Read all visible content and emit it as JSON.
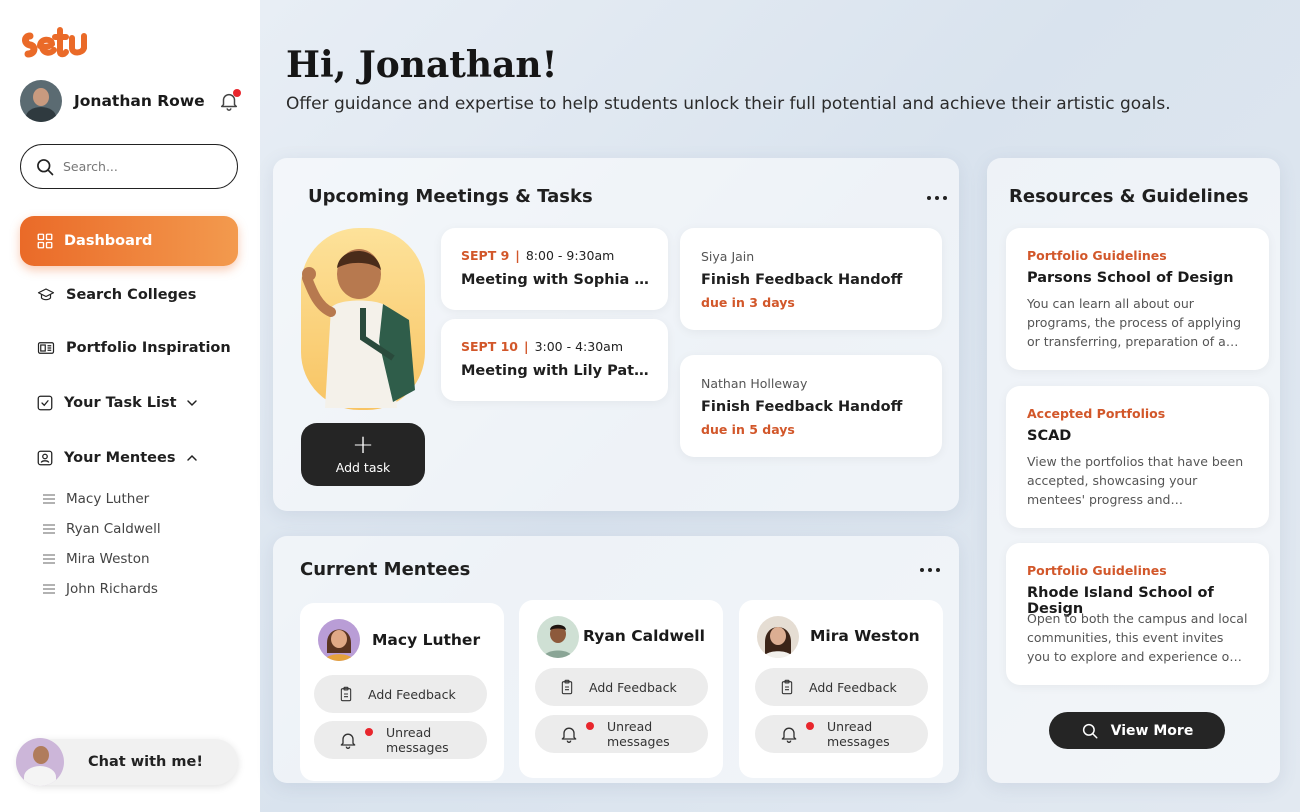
{
  "app": {
    "logo_text": "setu",
    "brand_color": "#ea6a28",
    "accent_text_color": "#d2572a"
  },
  "user": {
    "name": "Jonathan Rowe",
    "notification_dot": true
  },
  "search": {
    "placeholder": "Search..."
  },
  "nav": {
    "items": [
      {
        "label": "Dashboard",
        "icon": "grid-icon",
        "active": true
      },
      {
        "label": "Search Colleges",
        "icon": "graduation-cap-icon"
      },
      {
        "label": "Portfolio Inspiration",
        "icon": "gallery-icon"
      },
      {
        "label": "Your Task List",
        "icon": "checkbox-icon",
        "expanded": false
      },
      {
        "label": "Your Mentees",
        "icon": "person-badge-icon",
        "expanded": true
      }
    ],
    "mentees": [
      "Macy Luther",
      "Ryan Caldwell",
      "Mira Weston",
      "John Richards"
    ]
  },
  "chat": {
    "label": "Chat with me!"
  },
  "header": {
    "greeting": "Hi, Jonathan!",
    "subtitle": "Offer guidance and expertise to help students unlock their full potential and achieve their artistic goals."
  },
  "meetings": {
    "title": "Upcoming Meetings & Tasks",
    "add_task_label": "Add task",
    "items": [
      {
        "date": "SEPT 9",
        "time": "8:00 - 9:30am",
        "title": "Meeting with Sophia Rich"
      },
      {
        "date": "SEPT 10",
        "time": "3:00 - 4:30am",
        "title": "Meeting with Lily Patterson"
      }
    ],
    "tasks": [
      {
        "person": "Siya Jain",
        "title": "Finish Feedback Handoff",
        "due": "due in 3 days"
      },
      {
        "person": "Nathan Holleway",
        "title": "Finish Feedback Handoff",
        "due": "due in 5 days"
      }
    ]
  },
  "mentees": {
    "title": "Current Mentees",
    "feedback_label": "Add Feedback",
    "messages_label": "Unread messages",
    "items": [
      {
        "name": "Macy Luther"
      },
      {
        "name": "Ryan Caldwell"
      },
      {
        "name": "Mira Weston"
      }
    ]
  },
  "resources": {
    "title": "Resources & Guidelines",
    "view_more_label": "View More",
    "items": [
      {
        "label": "Portfolio Guidelines",
        "title": "Parsons School of Design",
        "desc": "You can learn all about our programs, the process of applying or transferring, preparation of a portfolio and more."
      },
      {
        "label": "Accepted Portfolios",
        "title": "SCAD",
        "desc": "View the portfolios that have been accepted, showcasing your mentees' progress and achievements."
      },
      {
        "label": "Portfolio Guidelines",
        "title": "Rhode Island School of Design",
        "desc": "Open to both the campus and local communities, this event invites you to explore and experience our programs."
      }
    ]
  }
}
